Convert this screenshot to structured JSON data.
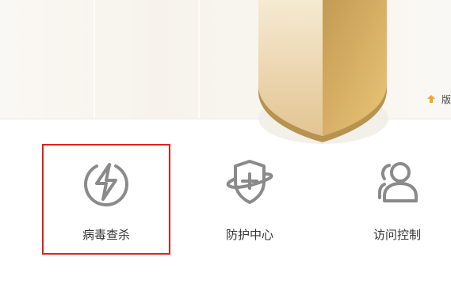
{
  "banner": {
    "update_label": "版"
  },
  "tiles": [
    {
      "label": "病毒查杀",
      "icon": "lightning-circle-icon",
      "selected": true
    },
    {
      "label": "防护中心",
      "icon": "shield-plus-icon",
      "selected": false
    },
    {
      "label": "访问控制",
      "icon": "users-icon",
      "selected": false
    }
  ],
  "colors": {
    "selection_border": "#e02020",
    "icon_gray": "#8a8a8a",
    "shield_gold_light": "#f0dcb4",
    "shield_gold_dark": "#c9a25a",
    "update_arrow": "#f5a623"
  }
}
